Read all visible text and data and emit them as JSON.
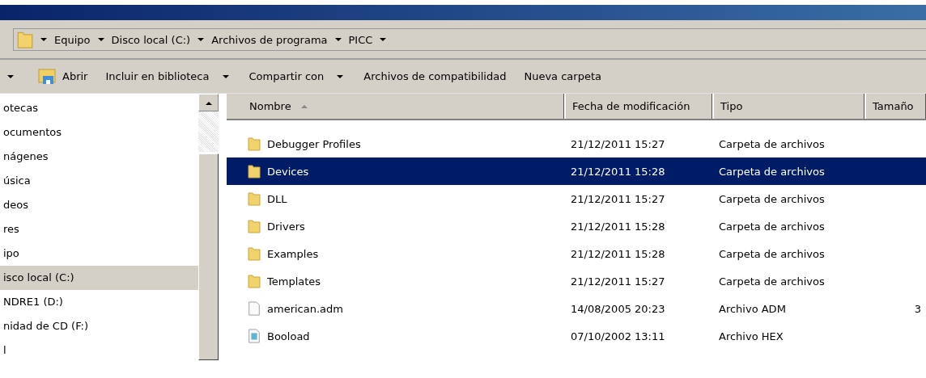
{
  "breadcrumb": [
    "Equipo",
    "Disco local (C:)",
    "Archivos de programa",
    "PICC"
  ],
  "toolbar": [
    {
      "label": "Abrir",
      "kind": "open"
    },
    {
      "label": "Incluir en biblioteca",
      "kind": "menu"
    },
    {
      "label": "Compartir con",
      "kind": "menu"
    },
    {
      "label": "Archivos de compatibilidad",
      "kind": "plain"
    },
    {
      "label": "Nueva carpeta",
      "kind": "plain"
    }
  ],
  "sidebar": {
    "items": [
      {
        "label": "otecas",
        "selected": false
      },
      {
        "label": "ocumentos",
        "selected": false
      },
      {
        "label": "nágenes",
        "selected": false
      },
      {
        "label": "úsica",
        "selected": false
      },
      {
        "label": "deos",
        "selected": false
      },
      {
        "label": "res",
        "selected": false
      },
      {
        "label": "ipo",
        "selected": false
      },
      {
        "label": "isco local (C:)",
        "selected": true
      },
      {
        "label": "NDRE1 (D:)",
        "selected": false
      },
      {
        "label": "nidad de CD (F:)",
        "selected": false
      },
      {
        "label": "l",
        "selected": false
      }
    ]
  },
  "table": {
    "columns": [
      "Nombre",
      "Fecha de modificación",
      "Tipo",
      "Tamaño"
    ],
    "rows": [
      {
        "name": "Debugger Profiles",
        "date": "21/12/2011 15:27",
        "type": "Carpeta de archivos",
        "size": "",
        "kind": "folder",
        "selected": false
      },
      {
        "name": "Devices",
        "date": "21/12/2011 15:28",
        "type": "Carpeta de archivos",
        "size": "",
        "kind": "folder",
        "selected": true
      },
      {
        "name": "DLL",
        "date": "21/12/2011 15:27",
        "type": "Carpeta de archivos",
        "size": "",
        "kind": "folder",
        "selected": false
      },
      {
        "name": "Drivers",
        "date": "21/12/2011 15:28",
        "type": "Carpeta de archivos",
        "size": "",
        "kind": "folder",
        "selected": false
      },
      {
        "name": "Examples",
        "date": "21/12/2011 15:28",
        "type": "Carpeta de archivos",
        "size": "",
        "kind": "folder",
        "selected": false
      },
      {
        "name": "Templates",
        "date": "21/12/2011 15:27",
        "type": "Carpeta de archivos",
        "size": "",
        "kind": "folder",
        "selected": false
      },
      {
        "name": "american.adm",
        "date": "14/08/2005 20:23",
        "type": "Archivo ADM",
        "size": "3",
        "kind": "file",
        "selected": false
      },
      {
        "name": "Booload",
        "date": "07/10/2002 13:11",
        "type": "Archivo HEX",
        "size": "",
        "kind": "hex",
        "selected": false
      }
    ]
  }
}
